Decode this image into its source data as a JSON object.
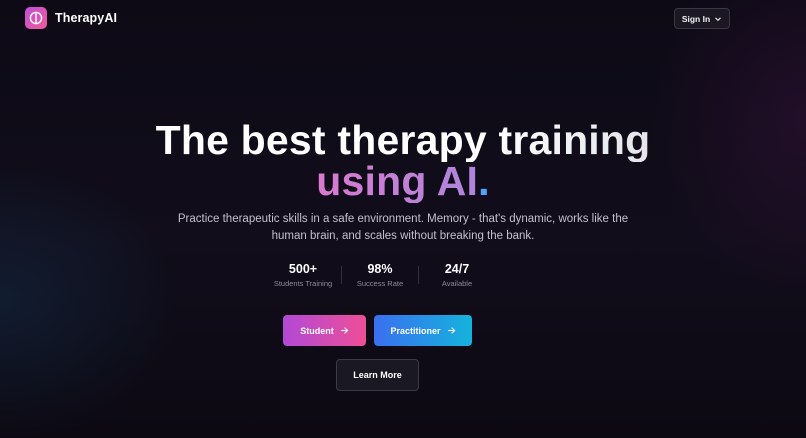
{
  "header": {
    "app_name": "TherapyAI",
    "logo_icon": "brain-circle-icon",
    "signin_label": "Sign In",
    "signin_icon": "chevron-down-icon"
  },
  "hero": {
    "title_line1": "The best therapy training",
    "title_line2_text": "using AI",
    "title_line2_dot": ".",
    "subtitle": "Practice therapeutic skills in a safe environment. Memory - that's dynamic, works like the human brain, and scales without breaking the bank."
  },
  "stats": [
    {
      "value": "500+",
      "label": "Students Training"
    },
    {
      "value": "98%",
      "label": "Success Rate"
    },
    {
      "value": "24/7",
      "label": "Available"
    }
  ],
  "buttons": {
    "student_label": "Student",
    "practitioner_label": "Practitioner",
    "learn_more_label": "Learn More",
    "arrow_icon": "arrow-right-icon"
  },
  "colors": {
    "background": "#110d1b",
    "brand_pink": "#ee4f97",
    "brand_purple": "#b249d6",
    "brand_blue": "#3b6ff0",
    "brand_cyan": "#14b3dd",
    "accent_dot": "#4fa3ff"
  }
}
